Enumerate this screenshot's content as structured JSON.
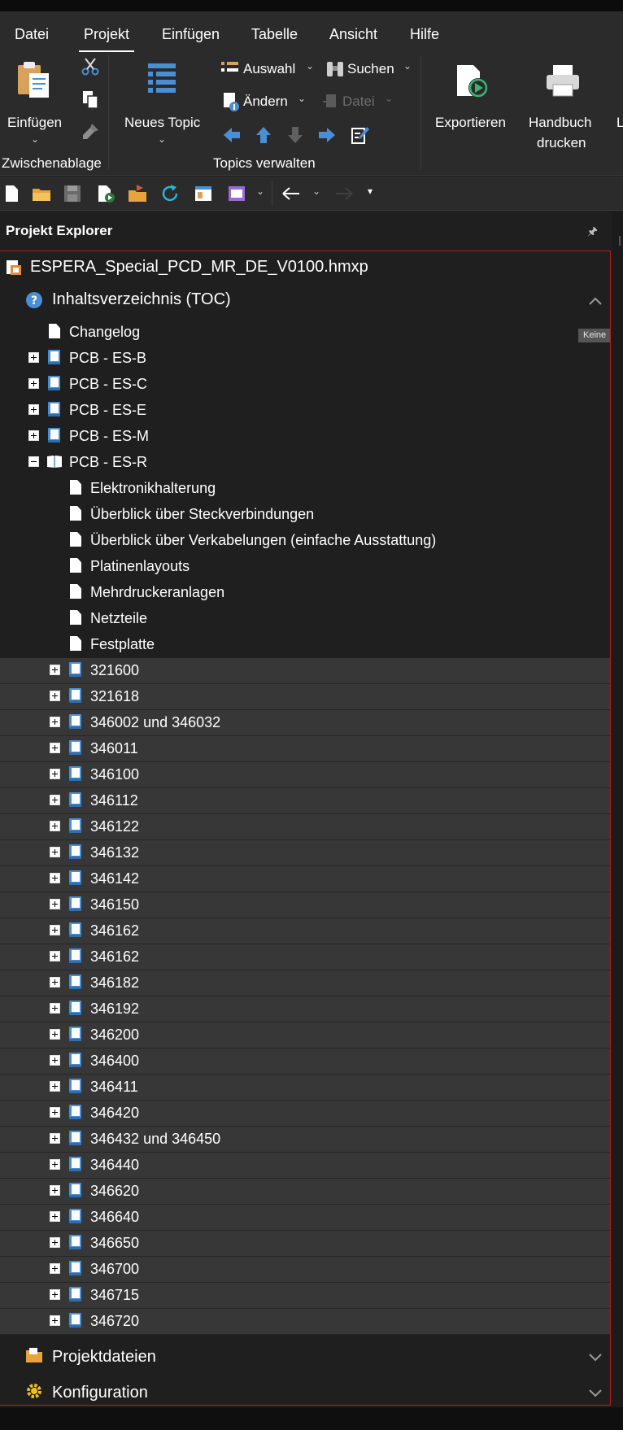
{
  "menu": {
    "tabs": [
      {
        "label": "Datei"
      },
      {
        "label": "Projekt",
        "active": true
      },
      {
        "label": "Einfügen"
      },
      {
        "label": "Tabelle"
      },
      {
        "label": "Ansicht"
      },
      {
        "label": "Hilfe"
      }
    ]
  },
  "ribbon": {
    "einfuegen_label": "Einfügen",
    "clipboard_group": "Zwischenablage",
    "neues_topic": "Neues Topic",
    "auswahl": "Auswahl",
    "suchen": "Suchen",
    "aendern": "Ändern",
    "datei": "Datei",
    "topics_group": "Topics verwalten",
    "exportieren": "Exportieren",
    "handbuch_line1": "Handbuch",
    "handbuch_line2": "drucken",
    "cut_edge": "L"
  },
  "explorer": {
    "title": "Projekt Explorer",
    "project_file": "ESPERA_Special_PCD_MR_DE_V0100.hmxp",
    "toc_label": "Inhaltsverzeichnis (TOC)",
    "tooltip": "Keine",
    "changelog": "Changelog",
    "pcb_items": [
      "PCB - ES-B",
      "PCB - ES-C",
      "PCB - ES-E",
      "PCB - ES-M",
      "PCB - ES-R"
    ],
    "es_r_children": [
      "Elektronikhalterung",
      "Überblick über Steckverbindungen",
      "Überblick über Verkabelungen (einfache Ausstattung)",
      "Platinenlayouts",
      "Mehrdruckeranlagen",
      "Netzteile",
      "Festplatte"
    ],
    "numbered_items": [
      "321600",
      "321618",
      "346002 und 346032",
      "346011",
      "346100",
      "346112",
      "346122",
      "346132",
      "346142",
      "346150",
      "346162",
      "346162",
      "346182",
      "346192",
      "346200",
      "346400",
      "346411",
      "346420",
      "346432 und 346450",
      "346440",
      "346620",
      "346640",
      "346650",
      "346700",
      "346715",
      "346720"
    ],
    "projektdateien": "Projektdateien",
    "konfiguration": "Konfiguration"
  },
  "colors": {
    "accent_blue": "#4a8fd6",
    "panel_border": "#b11d1d",
    "stripe_row": "#373737",
    "background": "#1f1f1f"
  }
}
